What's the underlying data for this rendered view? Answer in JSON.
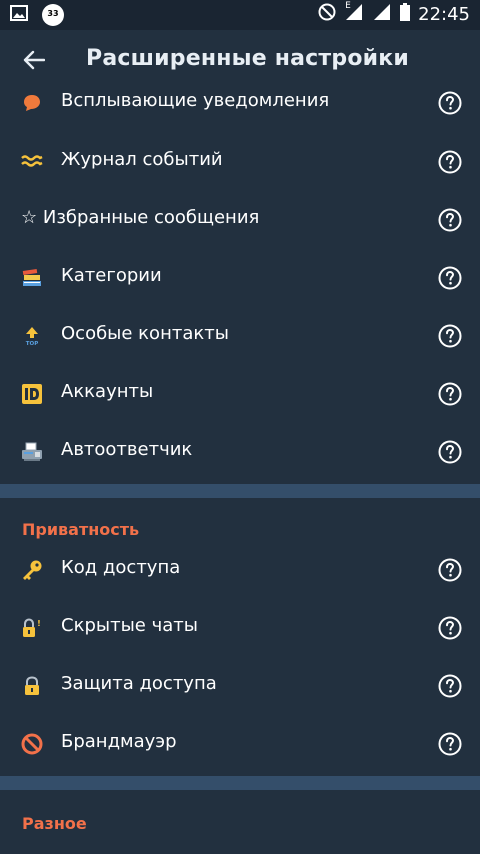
{
  "status_bar": {
    "time": "22:45",
    "notification_badge": "33",
    "network_label": "E",
    "icons": [
      "image-icon",
      "notification-badge-icon",
      "do-not-disturb-icon",
      "signal-icon",
      "signal-icon",
      "battery-icon"
    ]
  },
  "app_bar": {
    "back_icon": "arrow-left-icon",
    "title": "Расширенные настройки"
  },
  "settings": {
    "items": [
      {
        "label": "Всплывающие уведомления",
        "icon": "popup-bubble-icon"
      },
      {
        "label": "Журнал событий",
        "icon": "waves-icon"
      },
      {
        "label": "☆ Избранные сообщения",
        "icon": "star-icon"
      },
      {
        "label": "Категории",
        "icon": "books-icon"
      },
      {
        "label": "Особые контакты",
        "icon": "top-arrow-icon"
      },
      {
        "label": "Аккаунты",
        "icon": "id-card-icon"
      },
      {
        "label": "Автоответчик",
        "icon": "fax-icon"
      }
    ]
  },
  "privacy": {
    "title": "Приватность",
    "items": [
      {
        "label": "Код доступа",
        "icon": "key-icon"
      },
      {
        "label": "Скрытые чаты",
        "icon": "lock-icon"
      },
      {
        "label": "Защита доступа",
        "icon": "lock-icon"
      },
      {
        "label": "Брандмауэр",
        "icon": "no-entry-icon"
      }
    ]
  },
  "misc": {
    "title": "Разное"
  },
  "help_icon": "help-circle-icon",
  "colors": {
    "background": "#22303f",
    "separator": "#344e6a",
    "section_title": "#f2714a",
    "text": "#ffffff"
  }
}
